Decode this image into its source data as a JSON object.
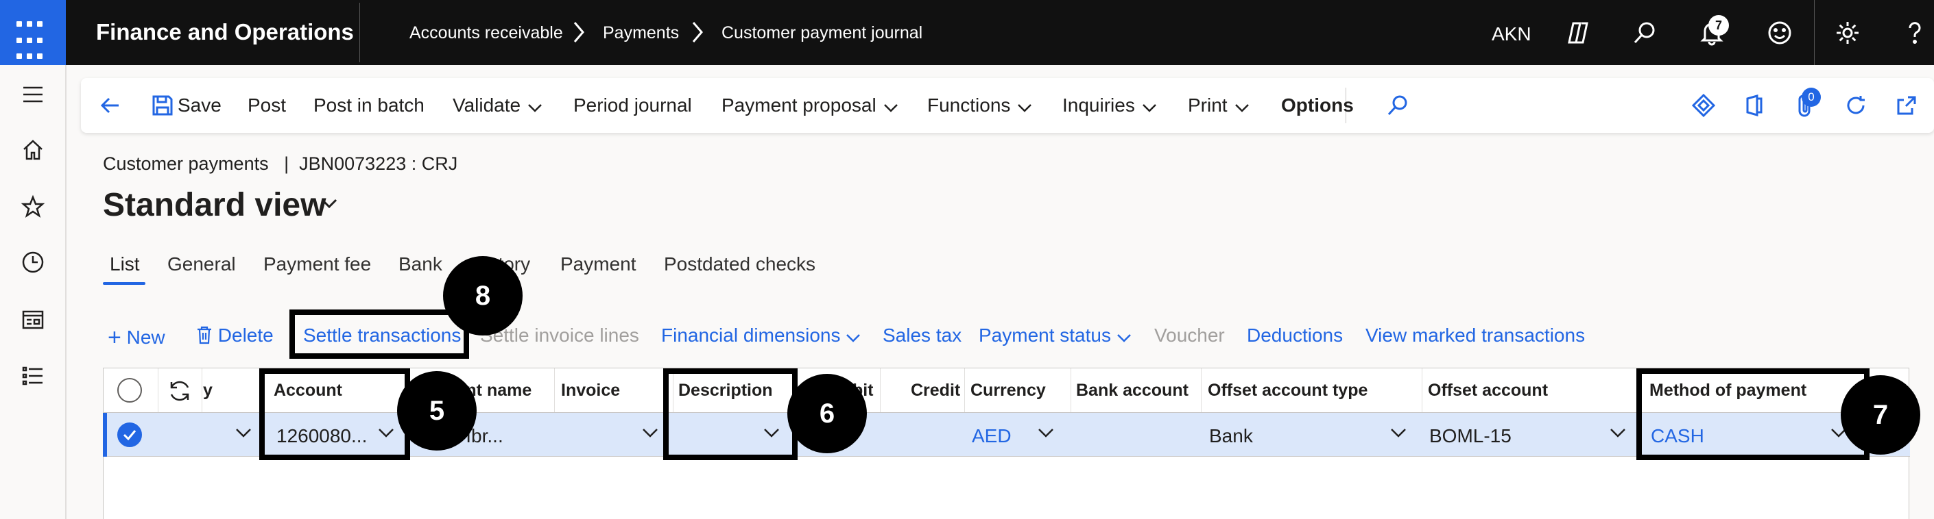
{
  "topbar": {
    "app_title": "Finance and Operations",
    "breadcrumbs": [
      "Accounts receivable",
      "Payments",
      "Customer payment journal"
    ],
    "user_initials": "AKN",
    "notification_count": "7",
    "icons": [
      "waffle-icon",
      "copilot-icon",
      "search-icon",
      "bell-icon",
      "smiley-icon",
      "gear-icon",
      "help-icon"
    ]
  },
  "leftnav": {
    "icons": [
      "hamburger-icon",
      "home-icon",
      "star-icon",
      "clock-icon",
      "workspace-icon",
      "list-icon"
    ]
  },
  "actionpane": {
    "save": "Save",
    "post": "Post",
    "post_in_batch": "Post in batch",
    "validate": "Validate",
    "period_journal": "Period journal",
    "payment_proposal": "Payment proposal",
    "functions": "Functions",
    "inquiries": "Inquiries",
    "print": "Print",
    "options": "Options",
    "attachment_count": "0"
  },
  "header": {
    "breadcrumb": "Customer payments   |  JBN0073223 : CRJ",
    "title": "Standard view"
  },
  "tabs": [
    "List",
    "General",
    "Payment fee",
    "Bank",
    "History",
    "Payment",
    "Postdated checks"
  ],
  "grid_toolbar": {
    "new": "New",
    "delete": "Delete",
    "settle_transactions": "Settle transactions",
    "settle_invoice_lines": "Settle invoice lines",
    "financial_dimensions": "Financial dimensions",
    "sales_tax": "Sales tax",
    "payment_status": "Payment status",
    "voucher": "Voucher",
    "deductions": "Deductions",
    "view_marked_transactions": "View marked transactions"
  },
  "grid": {
    "columns": {
      "partial": "y",
      "account": "Account",
      "name": "Account name",
      "invoice": "Invoice",
      "description": "Description",
      "debit": "Debit",
      "credit": "Credit",
      "currency": "Currency",
      "bank_account": "Bank account",
      "offset_account_type": "Offset account type",
      "offset_account": "Offset account",
      "method_of_payment": "Method of payment"
    },
    "row": {
      "account": "1260080...",
      "name": "Ali Ali Ibr...",
      "currency": "AED",
      "offset_account_type": "Bank",
      "offset_account": "BOML-15",
      "method_of_payment": "CASH"
    }
  },
  "callouts": [
    "5",
    "6",
    "7",
    "8"
  ],
  "colors": {
    "accent": "#2266e3",
    "topbar": "#111111",
    "selected_row": "#dbe7fa"
  }
}
